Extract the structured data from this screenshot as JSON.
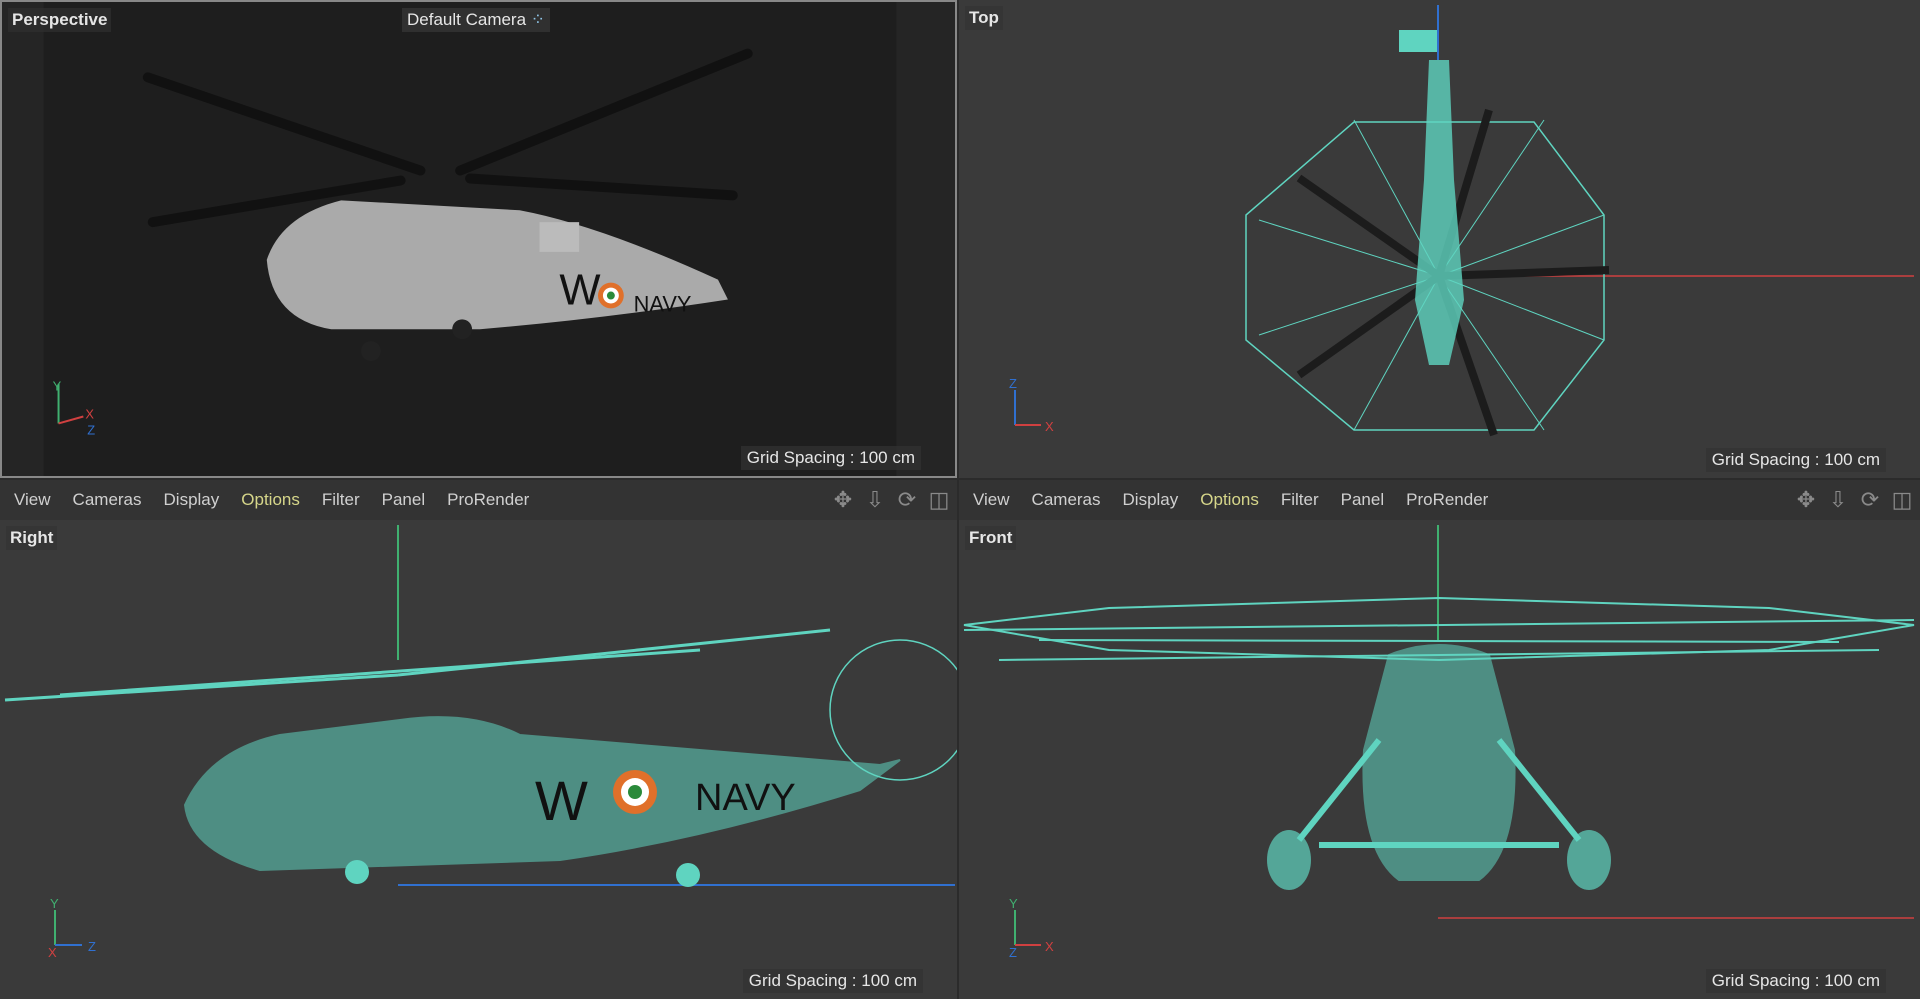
{
  "viewports": {
    "perspective": {
      "label": "Perspective",
      "camera": "Default Camera",
      "grid": "Grid Spacing : 100 cm"
    },
    "top": {
      "label": "Top",
      "grid": "Grid Spacing : 100 cm"
    },
    "right": {
      "label": "Right",
      "grid": "Grid Spacing : 100 cm"
    },
    "front": {
      "label": "Front",
      "grid": "Grid Spacing : 100 cm"
    }
  },
  "menu": [
    "View",
    "Cameras",
    "Display",
    "Options",
    "Filter",
    "Panel",
    "ProRender"
  ],
  "active_menu": "Options",
  "tool_icons": [
    "move-icon",
    "zoom-icon",
    "rotate-icon",
    "maximize-icon"
  ],
  "axes": {
    "x": "X",
    "y": "Y",
    "z": "Z"
  },
  "model_text": {
    "letter": "W",
    "navy": "NAVY"
  },
  "colors": {
    "wire": "#5fd4c0",
    "axis_x": "#d04040",
    "axis_y": "#40b070",
    "axis_z": "#3070d0",
    "active_menu": "#d6d68a"
  }
}
